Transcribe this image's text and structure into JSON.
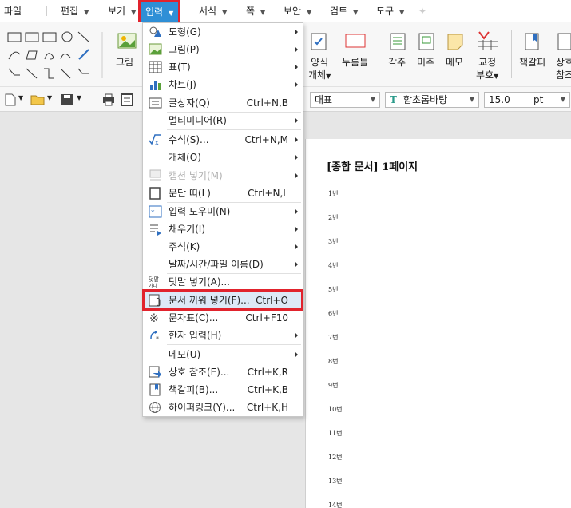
{
  "menubar": {
    "items": [
      {
        "label": "파일",
        "arrow": false
      },
      {
        "label": "편집",
        "arrow": true
      },
      {
        "label": "보기",
        "arrow": true
      },
      {
        "label": "입력",
        "arrow": true,
        "active": true
      },
      {
        "label": "서식",
        "arrow": true
      },
      {
        "label": "쪽",
        "arrow": true
      },
      {
        "label": "보안",
        "arrow": true
      },
      {
        "label": "검토",
        "arrow": true
      },
      {
        "label": "도구",
        "arrow": true
      }
    ]
  },
  "ribbon": {
    "picture_label": "그림",
    "right_groups": [
      {
        "label": "양식",
        "sub": "개체"
      },
      {
        "label": "누름틀",
        "sub": ""
      },
      {
        "label": "각주",
        "sub": ""
      },
      {
        "label": "미주",
        "sub": ""
      },
      {
        "label": "메모",
        "sub": ""
      },
      {
        "label": "교정",
        "sub": "부호"
      },
      {
        "label": "책갈피",
        "sub": ""
      },
      {
        "label": "상호",
        "sub": "참조"
      }
    ]
  },
  "toolbar": {
    "style_value": "대표",
    "font_value": "함초롬바탕",
    "size_value": "15.0",
    "unit_value": "pt"
  },
  "dropdown": {
    "items": [
      {
        "label": "도형(G)",
        "shortcut": "",
        "submenu": true,
        "icon": "shapes-icon"
      },
      {
        "label": "그림(P)",
        "shortcut": "",
        "submenu": true,
        "icon": "picture-icon"
      },
      {
        "label": "표(T)",
        "shortcut": "",
        "submenu": true,
        "icon": "table-icon"
      },
      {
        "label": "차트(J)",
        "shortcut": "",
        "submenu": true,
        "icon": "chart-icon"
      },
      {
        "label": "글상자(Q)",
        "shortcut": "Ctrl+N,B",
        "submenu": false,
        "icon": "textbox-icon"
      },
      {
        "label": "멀티미디어(R)",
        "shortcut": "",
        "submenu": true,
        "icon": ""
      },
      {
        "label": "수식(S)...",
        "shortcut": "Ctrl+N,M",
        "submenu": true,
        "icon": "formula-icon"
      },
      {
        "label": "개체(O)",
        "shortcut": "",
        "submenu": true,
        "icon": ""
      },
      {
        "label": "캡션 넣기(M)",
        "shortcut": "",
        "submenu": true,
        "icon": "caption-icon",
        "disabled": true
      },
      {
        "label": "문단 띠(L)",
        "shortcut": "Ctrl+N,L",
        "submenu": false,
        "icon": "paragraph-band-icon"
      },
      {
        "label": "입력 도우미(N)",
        "shortcut": "",
        "submenu": true,
        "icon": "input-helper-icon"
      },
      {
        "label": "채우기(I)",
        "shortcut": "",
        "submenu": true,
        "icon": "fill-icon"
      },
      {
        "label": "주석(K)",
        "shortcut": "",
        "submenu": true,
        "icon": ""
      },
      {
        "label": "날짜/시간/파일 이름(D)",
        "shortcut": "",
        "submenu": true,
        "icon": ""
      },
      {
        "label": "덧말 넣기(A)...",
        "shortcut": "",
        "submenu": false,
        "icon": "annotation-icon"
      },
      {
        "label": "문서 끼워 넣기(F)...",
        "shortcut": "Ctrl+O",
        "submenu": false,
        "icon": "insert-document-icon",
        "highlighted": true
      },
      {
        "label": "문자표(C)...",
        "shortcut": "Ctrl+F10",
        "submenu": false,
        "icon": "symbol-icon"
      },
      {
        "label": "한자 입력(H)",
        "shortcut": "",
        "submenu": true,
        "icon": "hanja-icon"
      },
      {
        "label": "메모(U)",
        "shortcut": "",
        "submenu": true,
        "icon": ""
      },
      {
        "label": "상호 참조(E)...",
        "shortcut": "Ctrl+K,R",
        "submenu": false,
        "icon": "cross-reference-icon"
      },
      {
        "label": "책갈피(B)...",
        "shortcut": "Ctrl+K,B",
        "submenu": false,
        "icon": "bookmark-icon"
      },
      {
        "label": "하이퍼링크(Y)...",
        "shortcut": "Ctrl+K,H",
        "submenu": false,
        "icon": "hyperlink-icon"
      }
    ]
  },
  "document": {
    "title": "[종합 문서] 1페이지",
    "lines": [
      "1번",
      "2번",
      "3번",
      "4번",
      "5번",
      "6번",
      "7번",
      "8번",
      "9번",
      "10번",
      "11번",
      "12번",
      "13번",
      "14번"
    ]
  },
  "colors": {
    "accent": "#2f8fd6",
    "highlight_border": "#e1232d",
    "menu_hover": "#dde9f7"
  }
}
